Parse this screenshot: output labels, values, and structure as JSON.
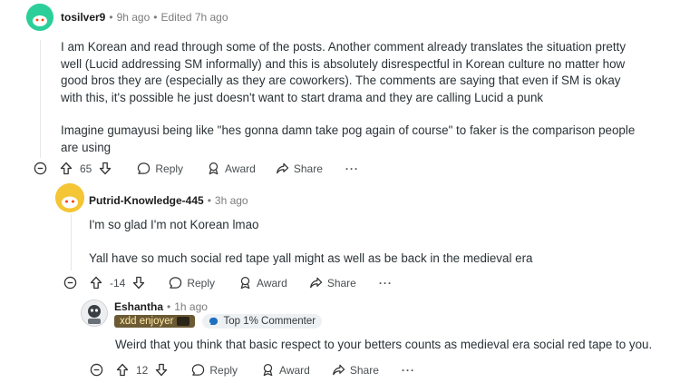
{
  "comments": [
    {
      "username": "tosilver9",
      "time": "9h ago",
      "edited": "Edited 7h ago",
      "paragraphs": [
        "I am Korean and read through some of the posts. Another comment already translates the situation pretty well (Lucid addressing SM informally) and this is absolutely disrespectful in Korean culture no matter how good bros they are (especially as they are coworkers). The comments are saying that even if SM is okay with this, it's possible he just doesn't want to start drama and they are calling Lucid a punk",
        "Imagine gumayusi being like \"hes gonna damn take pog again of course\" to faker is the comparison people are using"
      ],
      "score": "65",
      "reply_label": "Reply",
      "award_label": "Award",
      "share_label": "Share",
      "more_label": "···"
    },
    {
      "username": "Putrid-Knowledge-445",
      "time": "3h ago",
      "paragraphs": [
        "I'm so glad I'm not Korean lmao",
        "Yall have so much social red tape yall might as well as be back in the medieval era"
      ],
      "score": "-14",
      "reply_label": "Reply",
      "award_label": "Award",
      "share_label": "Share",
      "more_label": "···"
    },
    {
      "username": "Eshantha",
      "time": "1h ago",
      "user_flair": "xdd enjoyer",
      "top_flair": "Top 1% Commenter",
      "paragraphs": [
        "Weird that you think that basic respect to your betters counts as medieval era social red tape to you."
      ],
      "score": "12",
      "reply_label": "Reply",
      "award_label": "Award",
      "share_label": "Share",
      "more_label": "···"
    }
  ],
  "colors": {
    "avatar_1": "#2ccf9a",
    "avatar_2": "#f4c534",
    "text": "#2a3236",
    "muted": "#7c7c7c"
  },
  "icons": [
    "collapse-icon",
    "upvote-icon",
    "downvote-icon",
    "reply-icon",
    "award-icon",
    "share-icon",
    "more-icon"
  ]
}
